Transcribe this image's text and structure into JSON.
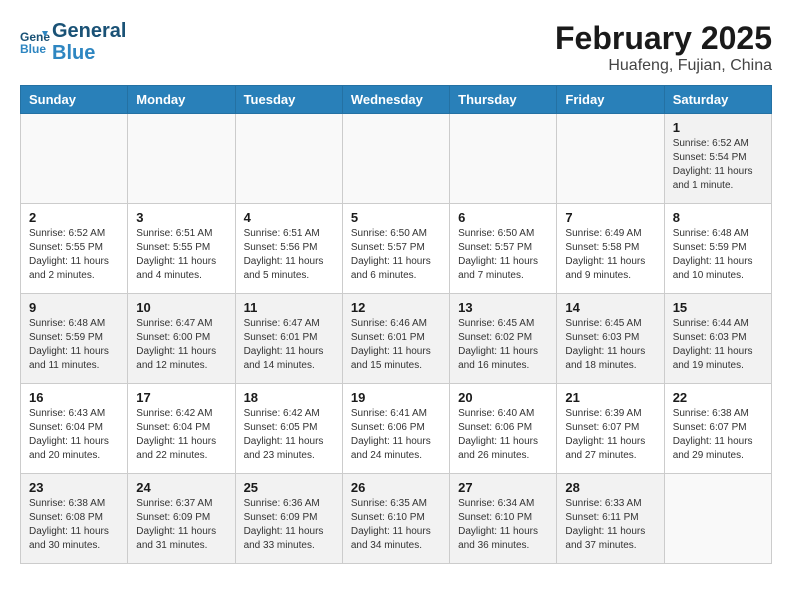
{
  "header": {
    "logo_line1": "General",
    "logo_line2": "Blue",
    "title": "February 2025",
    "subtitle": "Huafeng, Fujian, China"
  },
  "weekdays": [
    "Sunday",
    "Monday",
    "Tuesday",
    "Wednesday",
    "Thursday",
    "Friday",
    "Saturday"
  ],
  "weeks": [
    [
      {
        "day": "",
        "info": ""
      },
      {
        "day": "",
        "info": ""
      },
      {
        "day": "",
        "info": ""
      },
      {
        "day": "",
        "info": ""
      },
      {
        "day": "",
        "info": ""
      },
      {
        "day": "",
        "info": ""
      },
      {
        "day": "1",
        "info": "Sunrise: 6:52 AM\nSunset: 5:54 PM\nDaylight: 11 hours and 1 minute."
      }
    ],
    [
      {
        "day": "2",
        "info": "Sunrise: 6:52 AM\nSunset: 5:55 PM\nDaylight: 11 hours and 2 minutes."
      },
      {
        "day": "3",
        "info": "Sunrise: 6:51 AM\nSunset: 5:55 PM\nDaylight: 11 hours and 4 minutes."
      },
      {
        "day": "4",
        "info": "Sunrise: 6:51 AM\nSunset: 5:56 PM\nDaylight: 11 hours and 5 minutes."
      },
      {
        "day": "5",
        "info": "Sunrise: 6:50 AM\nSunset: 5:57 PM\nDaylight: 11 hours and 6 minutes."
      },
      {
        "day": "6",
        "info": "Sunrise: 6:50 AM\nSunset: 5:57 PM\nDaylight: 11 hours and 7 minutes."
      },
      {
        "day": "7",
        "info": "Sunrise: 6:49 AM\nSunset: 5:58 PM\nDaylight: 11 hours and 9 minutes."
      },
      {
        "day": "8",
        "info": "Sunrise: 6:48 AM\nSunset: 5:59 PM\nDaylight: 11 hours and 10 minutes."
      }
    ],
    [
      {
        "day": "9",
        "info": "Sunrise: 6:48 AM\nSunset: 5:59 PM\nDaylight: 11 hours and 11 minutes."
      },
      {
        "day": "10",
        "info": "Sunrise: 6:47 AM\nSunset: 6:00 PM\nDaylight: 11 hours and 12 minutes."
      },
      {
        "day": "11",
        "info": "Sunrise: 6:47 AM\nSunset: 6:01 PM\nDaylight: 11 hours and 14 minutes."
      },
      {
        "day": "12",
        "info": "Sunrise: 6:46 AM\nSunset: 6:01 PM\nDaylight: 11 hours and 15 minutes."
      },
      {
        "day": "13",
        "info": "Sunrise: 6:45 AM\nSunset: 6:02 PM\nDaylight: 11 hours and 16 minutes."
      },
      {
        "day": "14",
        "info": "Sunrise: 6:45 AM\nSunset: 6:03 PM\nDaylight: 11 hours and 18 minutes."
      },
      {
        "day": "15",
        "info": "Sunrise: 6:44 AM\nSunset: 6:03 PM\nDaylight: 11 hours and 19 minutes."
      }
    ],
    [
      {
        "day": "16",
        "info": "Sunrise: 6:43 AM\nSunset: 6:04 PM\nDaylight: 11 hours and 20 minutes."
      },
      {
        "day": "17",
        "info": "Sunrise: 6:42 AM\nSunset: 6:04 PM\nDaylight: 11 hours and 22 minutes."
      },
      {
        "day": "18",
        "info": "Sunrise: 6:42 AM\nSunset: 6:05 PM\nDaylight: 11 hours and 23 minutes."
      },
      {
        "day": "19",
        "info": "Sunrise: 6:41 AM\nSunset: 6:06 PM\nDaylight: 11 hours and 24 minutes."
      },
      {
        "day": "20",
        "info": "Sunrise: 6:40 AM\nSunset: 6:06 PM\nDaylight: 11 hours and 26 minutes."
      },
      {
        "day": "21",
        "info": "Sunrise: 6:39 AM\nSunset: 6:07 PM\nDaylight: 11 hours and 27 minutes."
      },
      {
        "day": "22",
        "info": "Sunrise: 6:38 AM\nSunset: 6:07 PM\nDaylight: 11 hours and 29 minutes."
      }
    ],
    [
      {
        "day": "23",
        "info": "Sunrise: 6:38 AM\nSunset: 6:08 PM\nDaylight: 11 hours and 30 minutes."
      },
      {
        "day": "24",
        "info": "Sunrise: 6:37 AM\nSunset: 6:09 PM\nDaylight: 11 hours and 31 minutes."
      },
      {
        "day": "25",
        "info": "Sunrise: 6:36 AM\nSunset: 6:09 PM\nDaylight: 11 hours and 33 minutes."
      },
      {
        "day": "26",
        "info": "Sunrise: 6:35 AM\nSunset: 6:10 PM\nDaylight: 11 hours and 34 minutes."
      },
      {
        "day": "27",
        "info": "Sunrise: 6:34 AM\nSunset: 6:10 PM\nDaylight: 11 hours and 36 minutes."
      },
      {
        "day": "28",
        "info": "Sunrise: 6:33 AM\nSunset: 6:11 PM\nDaylight: 11 hours and 37 minutes."
      },
      {
        "day": "",
        "info": ""
      }
    ]
  ]
}
